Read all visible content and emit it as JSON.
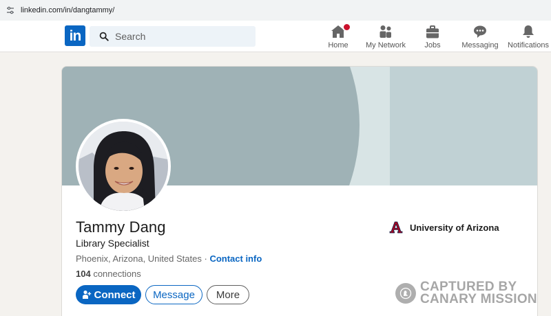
{
  "browser": {
    "url": "linkedin.com/in/dangtammy/"
  },
  "navbar": {
    "logo_text": "in",
    "search": {
      "placeholder": "Search"
    },
    "items": [
      {
        "label": "Home",
        "icon": "home-icon",
        "has_badge": true
      },
      {
        "label": "My Network",
        "icon": "network-icon"
      },
      {
        "label": "Jobs",
        "icon": "briefcase-icon"
      },
      {
        "label": "Messaging",
        "icon": "messaging-icon"
      },
      {
        "label": "Notifications",
        "icon": "bell-icon"
      }
    ]
  },
  "profile": {
    "name": "Tammy Dang",
    "headline": "Library Specialist",
    "location": "Phoenix, Arizona, United States",
    "separator": "·",
    "contact_label": "Contact info",
    "connections_count": "104",
    "connections_label": "connections",
    "education": "University of Arizona",
    "buttons": {
      "connect": "Connect",
      "message": "Message",
      "more": "More"
    }
  },
  "watermark": {
    "line1": "CAPTURED BY",
    "line2": "CANARY MISSION"
  },
  "colors": {
    "brand": "#0a66c2",
    "badge": "#cb112d",
    "banner_light": "#c0d1d4",
    "banner_dark": "#9fb2b6",
    "arizona_red": "#ab0520",
    "arizona_navy": "#0c234b"
  }
}
